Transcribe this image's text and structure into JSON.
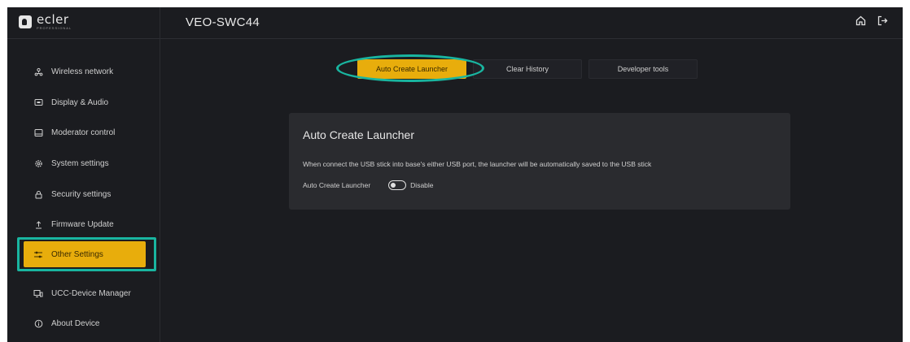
{
  "brand": {
    "name": "ecler",
    "subtitle": "PROFESSIONAL"
  },
  "header": {
    "device_name": "VEO-SWC44",
    "icons": [
      "home-icon",
      "logout-icon"
    ]
  },
  "sidebar": {
    "items": [
      {
        "label": "Wireless network",
        "icon": "wireless-icon"
      },
      {
        "label": "Display & Audio",
        "icon": "display-icon"
      },
      {
        "label": "Moderator control",
        "icon": "moderator-icon"
      },
      {
        "label": "System settings",
        "icon": "gear-icon"
      },
      {
        "label": "Security settings",
        "icon": "lock-icon"
      },
      {
        "label": "Firmware Update",
        "icon": "upload-icon"
      },
      {
        "label": "Other Settings",
        "icon": "sliders-icon",
        "active": true
      },
      {
        "label": "UCC-Device Manager",
        "icon": "device-manager-icon"
      },
      {
        "label": "About Device",
        "icon": "info-icon"
      }
    ]
  },
  "tabs": [
    {
      "label": "Auto Create Launcher",
      "active": true
    },
    {
      "label": "Clear History"
    },
    {
      "label": "Developer tools"
    }
  ],
  "panel": {
    "title": "Auto Create Launcher",
    "description": "When connect the USB stick into base's either USB port, the launcher will be automatically saved to the USB stick",
    "setting_label": "Auto Create Launcher",
    "toggle_state": "Disable"
  },
  "colors": {
    "accent": "#e8ad0c",
    "highlight": "#19b5a0",
    "background": "#1b1c20",
    "panel": "#2a2b2f"
  }
}
